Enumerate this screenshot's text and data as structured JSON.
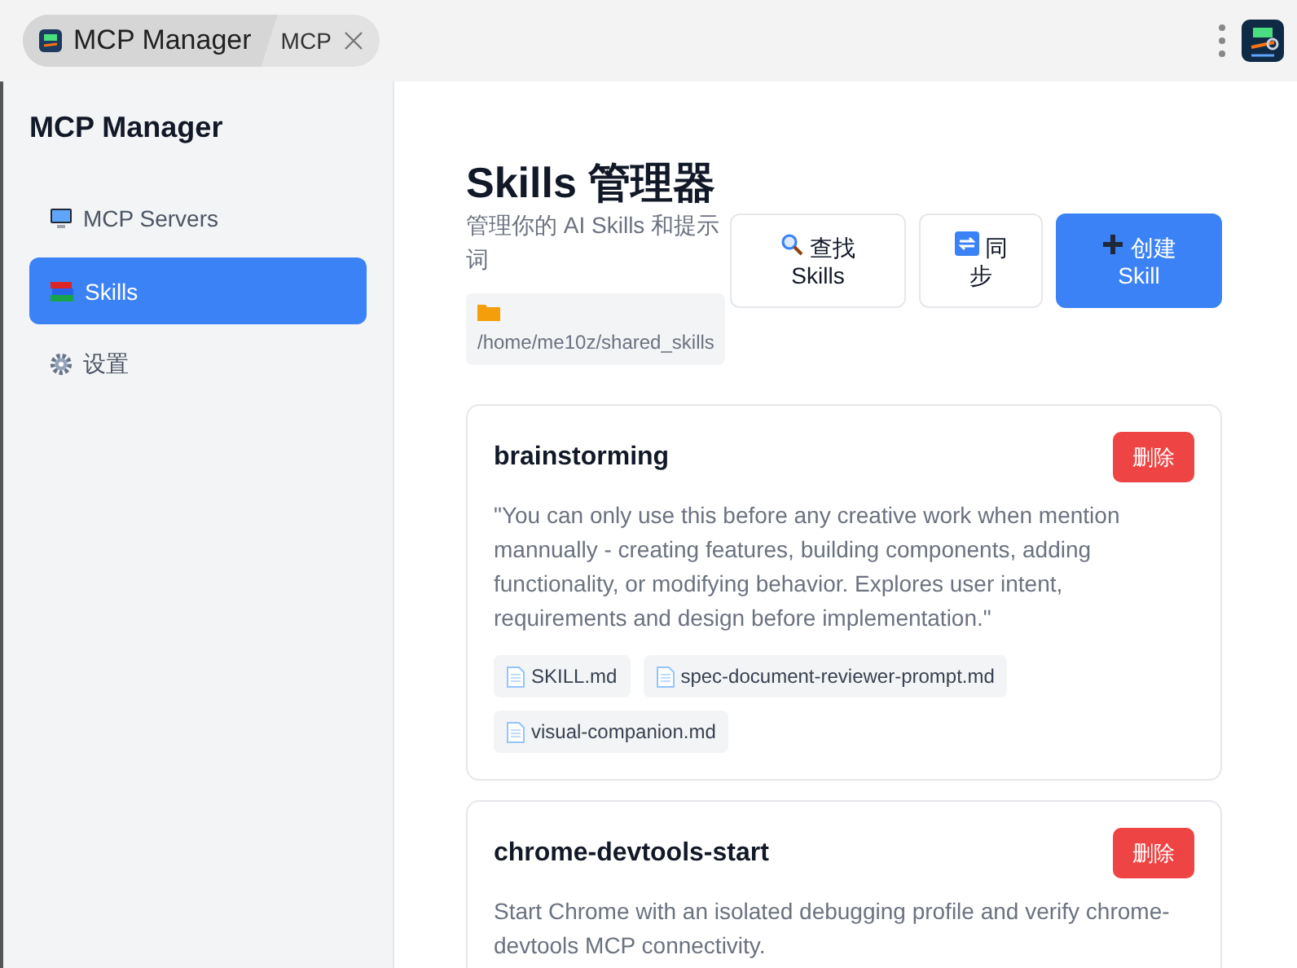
{
  "browser_tab": {
    "group_label": "MCP Manager",
    "tab_title": "MCP"
  },
  "sidebar": {
    "title": "MCP Manager",
    "items": [
      {
        "label": "MCP Servers",
        "selected": false
      },
      {
        "label": "Skills",
        "selected": true
      },
      {
        "label": "设置",
        "selected": false
      }
    ]
  },
  "header": {
    "title": "Skills 管理器",
    "subtitle": "管理你的 AI Skills 和提示词",
    "path": "/home/me10z/shared_skills",
    "buttons": [
      {
        "label": "查找 Skills",
        "kind": "secondary"
      },
      {
        "label": "同步",
        "kind": "secondary"
      },
      {
        "label": "创建 Skill",
        "kind": "primary"
      }
    ]
  },
  "skills": [
    {
      "name": "brainstorming",
      "delete_label": "删除",
      "description": "\"You can only use this before any creative work when mention mannually - creating features, building components, adding functionality, or modifying behavior. Explores user intent, requirements and design before implementation.\"",
      "files": [
        "SKILL.md",
        "spec-document-reviewer-prompt.md",
        "visual-companion.md"
      ]
    },
    {
      "name": "chrome-devtools-start",
      "delete_label": "删除",
      "description": "Start Chrome with an isolated debugging profile and verify chrome-devtools MCP connectivity."
    }
  ]
}
